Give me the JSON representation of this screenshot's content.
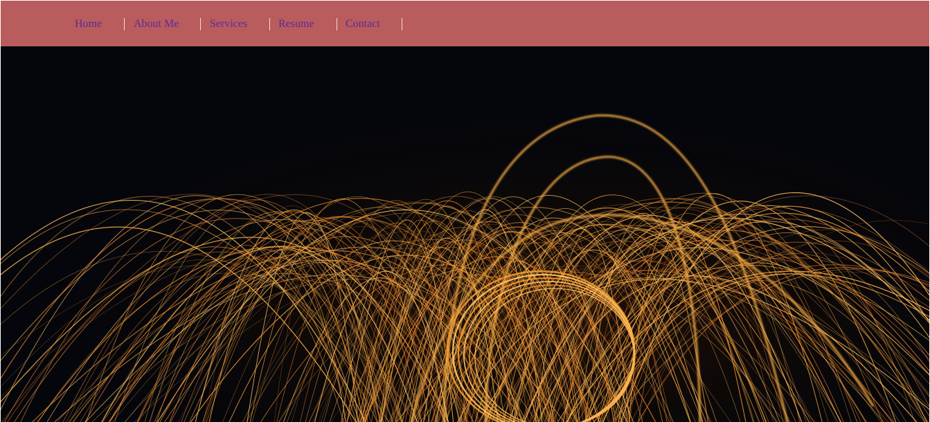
{
  "nav": {
    "items": [
      {
        "label": "Home"
      },
      {
        "label": "About Me"
      },
      {
        "label": "Services"
      },
      {
        "label": "Resume"
      },
      {
        "label": "Contact"
      }
    ]
  },
  "colors": {
    "navbar_background": "#b85c5d",
    "nav_link": "#5b2a9a",
    "nav_separator": "#f1dcdc",
    "hero_background": "#05060b",
    "spark": "#f0a33c"
  },
  "hero": {
    "image_subject": "steel wool spinning long-exposure sparks"
  }
}
